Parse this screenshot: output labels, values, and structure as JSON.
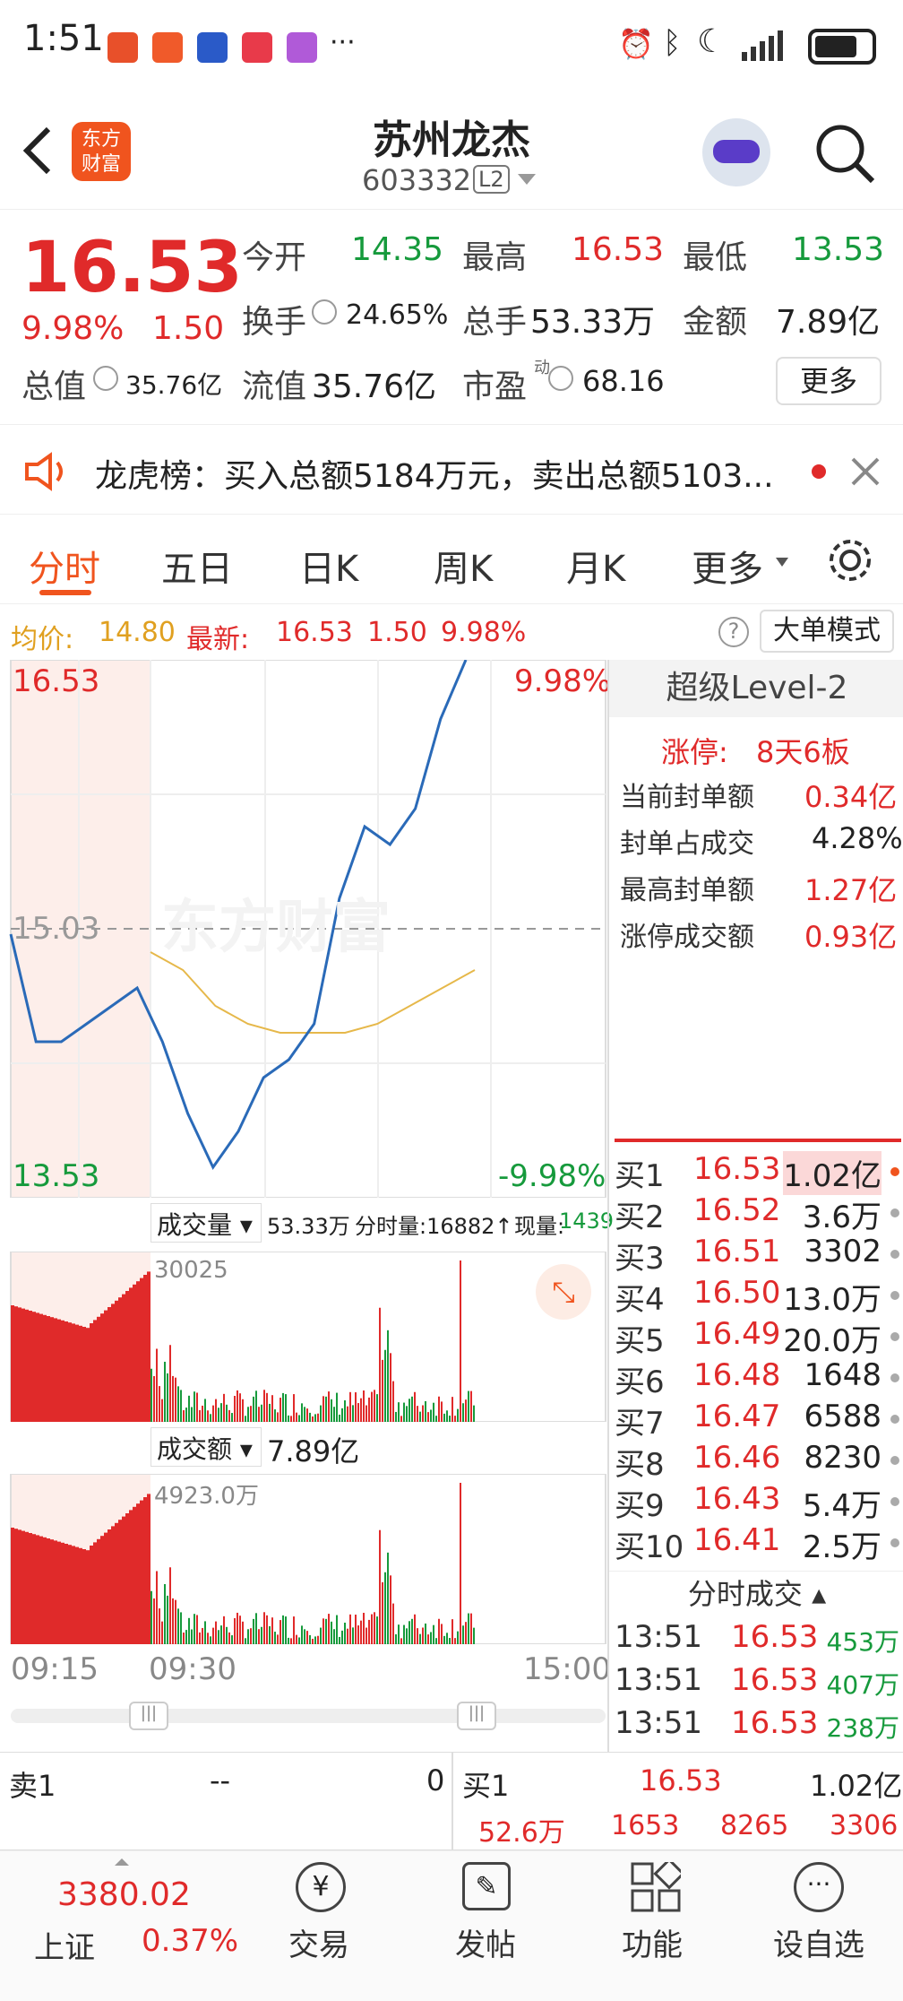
{
  "status": {
    "time": "1:51",
    "dots": "···"
  },
  "nav": {
    "title": "苏州龙杰",
    "code": "603332",
    "level_badge": "L2",
    "logo_line1": "东方",
    "logo_line2": "财富"
  },
  "quote": {
    "price": "16.53",
    "pct": "9.98%",
    "chg": "1.50",
    "open_label": "今开",
    "open": "14.35",
    "high_label": "最高",
    "high": "16.53",
    "low_label": "最低",
    "low": "13.53",
    "turnover_label": "换手",
    "turnover": "24.65%",
    "vol_label": "总手",
    "vol": "53.33万",
    "amount_label": "金额",
    "amount": "7.89亿",
    "mcap_label": "总值",
    "mcap": "35.76亿",
    "float_label": "流值",
    "float": "35.76亿",
    "pe_label": "市盈",
    "pe_sup": "动",
    "pe": "68.16",
    "more": "更多"
  },
  "notice": {
    "text": "龙虎榜：买入总额5184万元，卖出总额5103..."
  },
  "tabs": [
    "分时",
    "五日",
    "日K",
    "周K",
    "月K",
    "更多"
  ],
  "avg_line": {
    "avg_label": "均价:",
    "avg": "14.80",
    "latest_label": "最新:",
    "latest": "16.53",
    "chg": "1.50",
    "pct": "9.98%",
    "mode_btn": "大单模式",
    "help": "?"
  },
  "chart": {
    "top_price": "16.53",
    "top_pct": "9.98%",
    "mid_price": "15.03",
    "low_price": "13.53",
    "low_pct": "-9.98%",
    "watermark": "东方财富",
    "vol_selector": "成交量",
    "vol_total": "53.33万",
    "vol_fen": "分时量:16882↑",
    "vol_now_label": "现量:",
    "vol_now": "1439",
    "vol_max": "30025",
    "amt_selector": "成交额",
    "amt_total": "7.89亿",
    "amt_max": "4923.0万",
    "time_start": "09:15",
    "time_open": "09:30",
    "time_end": "15:00"
  },
  "chart_data": {
    "type": "line",
    "title": "",
    "ylim": [
      13.53,
      16.53
    ],
    "series": [
      {
        "values": [
          15.0,
          14.4,
          14.4,
          14.5,
          14.6,
          14.7,
          14.4,
          14.0,
          13.7,
          13.9,
          14.2,
          14.3,
          14.5,
          15.2,
          15.6,
          15.5,
          15.7,
          16.2,
          16.53
        ]
      },
      {
        "values": [
          14.9,
          14.8,
          14.6,
          14.5,
          14.45,
          14.45,
          14.45,
          14.5,
          14.6,
          14.7,
          14.8
        ]
      }
    ]
  },
  "panel": {
    "title": "超级Level-2",
    "limit_label": "涨停:",
    "limit_val": "8天6板",
    "rows": [
      {
        "k": "当前封单额",
        "v": "0.34亿"
      },
      {
        "k": "封单占成交",
        "v": "4.28%"
      },
      {
        "k": "最高封单额",
        "v": "1.27亿"
      },
      {
        "k": "涨停成交额",
        "v": "0.93亿"
      }
    ],
    "bids": [
      {
        "n": "买1",
        "p": "16.53",
        "v": "1.02亿"
      },
      {
        "n": "买2",
        "p": "16.52",
        "v": "3.6万"
      },
      {
        "n": "买3",
        "p": "16.51",
        "v": "3302"
      },
      {
        "n": "买4",
        "p": "16.50",
        "v": "13.0万"
      },
      {
        "n": "买5",
        "p": "16.49",
        "v": "20.0万"
      },
      {
        "n": "买6",
        "p": "16.48",
        "v": "1648"
      },
      {
        "n": "买7",
        "p": "16.47",
        "v": "6588"
      },
      {
        "n": "买8",
        "p": "16.46",
        "v": "8230"
      },
      {
        "n": "买9",
        "p": "16.43",
        "v": "5.4万"
      },
      {
        "n": "买10",
        "p": "16.41",
        "v": "2.5万"
      }
    ],
    "ticks_title": "分时成交",
    "ticks": [
      {
        "t": "13:51",
        "p": "16.53",
        "v": "453万"
      },
      {
        "t": "13:51",
        "p": "16.53",
        "v": "407万"
      },
      {
        "t": "13:51",
        "p": "16.53",
        "v": "238万"
      }
    ]
  },
  "strip": {
    "sell_label": "卖1",
    "sell_price": "--",
    "sell_vol": "0",
    "buy_label": "买1",
    "buy_price": "16.53",
    "buy_vol": "1.02亿",
    "q1": "52.6万",
    "q2": "1653",
    "q3": "8265",
    "q4": "3306"
  },
  "bottom": {
    "index_val": "3380.02",
    "index_name": "上证",
    "index_pct": "0.37%",
    "trade": "交易",
    "post": "发帖",
    "func": "功能",
    "fav": "设自选"
  }
}
